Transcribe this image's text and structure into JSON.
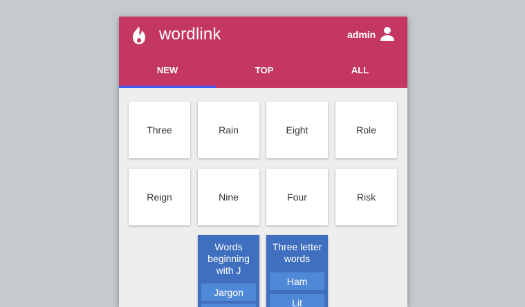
{
  "app": {
    "title": "wordlink",
    "logo_icon": "flame-icon"
  },
  "user": {
    "name": "admin",
    "icon": "account-icon"
  },
  "tabs": [
    {
      "label": "NEW",
      "active": true
    },
    {
      "label": "TOP",
      "active": false
    },
    {
      "label": "ALL",
      "active": false
    }
  ],
  "words": [
    "Three",
    "Rain",
    "Eight",
    "Role",
    "Reign",
    "Nine",
    "Four",
    "Risk"
  ],
  "categories": [
    {
      "title": "Words beginning with J",
      "items": [
        "Jargon",
        ""
      ]
    },
    {
      "title": "Three letter words",
      "items": [
        "Ham",
        "Lit"
      ]
    }
  ],
  "colors": {
    "appbar": "#c33762",
    "tab_indicator": "#3d5afe",
    "category_card": "#3f6fbe",
    "category_item": "#5088d8",
    "background": "#eeeeee"
  }
}
